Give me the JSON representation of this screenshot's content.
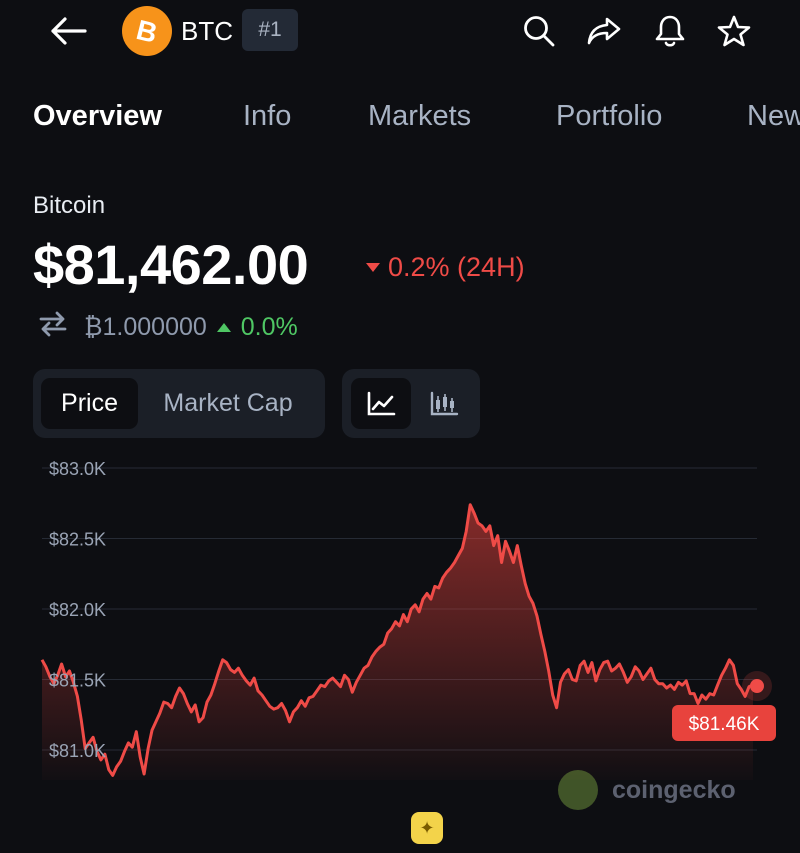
{
  "header": {
    "coin_symbol": "BTC",
    "rank": "#1",
    "icons": [
      "back-arrow-icon",
      "bitcoin-logo-icon",
      "search-icon",
      "share-icon",
      "bell-icon",
      "star-icon"
    ]
  },
  "tabs": [
    {
      "label": "Overview",
      "active": true
    },
    {
      "label": "Info",
      "active": false
    },
    {
      "label": "Markets",
      "active": false
    },
    {
      "label": "Portfolio",
      "active": false
    },
    {
      "label": "News",
      "active": false
    }
  ],
  "coin": {
    "name": "Bitcoin",
    "price": "$81,462.00",
    "change_24h": "0.2% (24H)",
    "btc_price": "₿1.000000",
    "btc_change": "0.0%"
  },
  "toggles": {
    "price_label": "Price",
    "market_cap_label": "Market Cap",
    "chart_icons": [
      "line-chart-icon",
      "candlestick-icon"
    ]
  },
  "colors": {
    "background": "#0d0e12",
    "negative": "#ef4b47",
    "positive": "#4fc764",
    "bitcoin": "#f7931a"
  },
  "chart_data": {
    "type": "area",
    "ylim": [
      81000,
      83000
    ],
    "ytick_labels": [
      "$83.0K",
      "$82.5K",
      "$82.0K",
      "$81.5K",
      "$81.0K"
    ],
    "yticks": [
      83000,
      82500,
      82000,
      81500,
      81000
    ],
    "current_label": "$81.46K",
    "grid": true,
    "values": [
      81640,
      81590,
      81520,
      81470,
      81530,
      81610,
      81520,
      81560,
      81480,
      81380,
      81210,
      81010,
      81050,
      81090,
      80990,
      80930,
      80970,
      80860,
      80820,
      80880,
      80920,
      80990,
      81050,
      81020,
      81130,
      80950,
      80830,
      81010,
      81140,
      81200,
      81260,
      81340,
      81330,
      81300,
      81380,
      81440,
      81400,
      81330,
      81270,
      81320,
      81200,
      81230,
      81340,
      81390,
      81470,
      81560,
      81640,
      81620,
      81570,
      81550,
      81580,
      81530,
      81490,
      81460,
      81510,
      81420,
      81390,
      81350,
      81310,
      81290,
      81300,
      81330,
      81280,
      81200,
      81270,
      81300,
      81350,
      81310,
      81370,
      81380,
      81420,
      81460,
      81450,
      81490,
      81510,
      81480,
      81450,
      81530,
      81500,
      81410,
      81480,
      81530,
      81580,
      81600,
      81660,
      81700,
      81730,
      81750,
      81830,
      81860,
      81910,
      81880,
      81960,
      81910,
      82000,
      82030,
      81980,
      82070,
      82110,
      82070,
      82160,
      82150,
      82220,
      82260,
      82290,
      82330,
      82380,
      82430,
      82550,
      82740,
      82680,
      82610,
      82590,
      82550,
      82590,
      82450,
      82520,
      82330,
      82480,
      82410,
      82330,
      82450,
      82310,
      82180,
      82090,
      82040,
      81950,
      81820,
      81700,
      81560,
      81390,
      81300,
      81480,
      81540,
      81570,
      81500,
      81490,
      81600,
      81630,
      81550,
      81620,
      81490,
      81570,
      81620,
      81630,
      81560,
      81580,
      81610,
      81550,
      81480,
      81520,
      81590,
      81560,
      81500,
      81540,
      81580,
      81500,
      81470,
      81470,
      81440,
      81460,
      81430,
      81480,
      81460,
      81490,
      81400,
      81400,
      81330,
      81390,
      81360,
      81400,
      81390,
      81460,
      81530,
      81580,
      81640,
      81600,
      81470,
      81430,
      81380,
      81450,
      81462
    ]
  },
  "watermark": "coingecko"
}
